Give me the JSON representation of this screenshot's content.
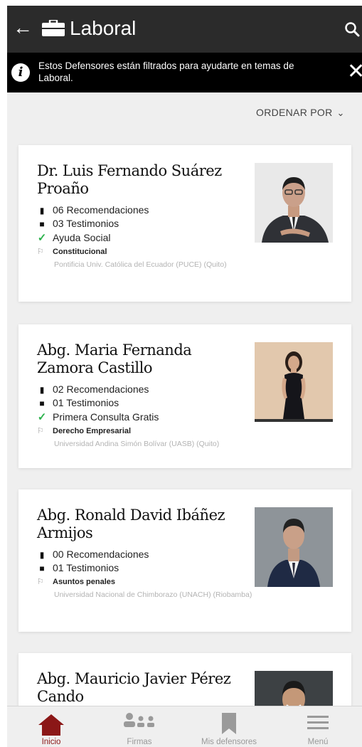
{
  "header": {
    "title": "Laboral"
  },
  "banner": {
    "text": "Estos Defensores están filtrados para ayudarte en temas de Laboral."
  },
  "sort": {
    "label": "ORDENAR POR"
  },
  "lawyers": [
    {
      "name": "Dr. Luis Fernando Suárez Proaño",
      "recommendations": "06 Recomendaciones",
      "testimonials": "03 Testimonios",
      "perk": "Ayuda Social",
      "specialty": "Constitucional",
      "university": "Pontificia Univ. Católica del Ecuador (PUCE) (Quito)"
    },
    {
      "name": "Abg. Maria Fernanda Zamora Castillo",
      "recommendations": "02 Recomendaciones",
      "testimonials": "01 Testimonios",
      "perk": "Primera Consulta Gratis",
      "specialty": "Derecho Empresarial",
      "university": "Universidad Andina Simón Bolívar (UASB) (Quito)"
    },
    {
      "name": "Abg. Ronald David Ibáñez Armijos",
      "recommendations": "00 Recomendaciones",
      "testimonials": "01 Testimonios",
      "specialty": "Asuntos penales",
      "university": "Universidad Nacional de Chimborazo (UNACH) (Riobamba)"
    },
    {
      "name": "Abg. Mauricio Javier Pérez Cando"
    }
  ],
  "tabs": [
    {
      "label": "Inicio",
      "icon": "home-icon",
      "active": true
    },
    {
      "label": "Firmas",
      "icon": "group-icon"
    },
    {
      "label": "Mis defensores",
      "icon": "bookmark-icon"
    },
    {
      "label": "Menú",
      "icon": "menu-icon"
    }
  ],
  "colors": {
    "topbar": "#2b2b2b",
    "banner": "#000000",
    "accent": "#8b1717",
    "check": "#2bb24c",
    "background": "#efefef"
  }
}
